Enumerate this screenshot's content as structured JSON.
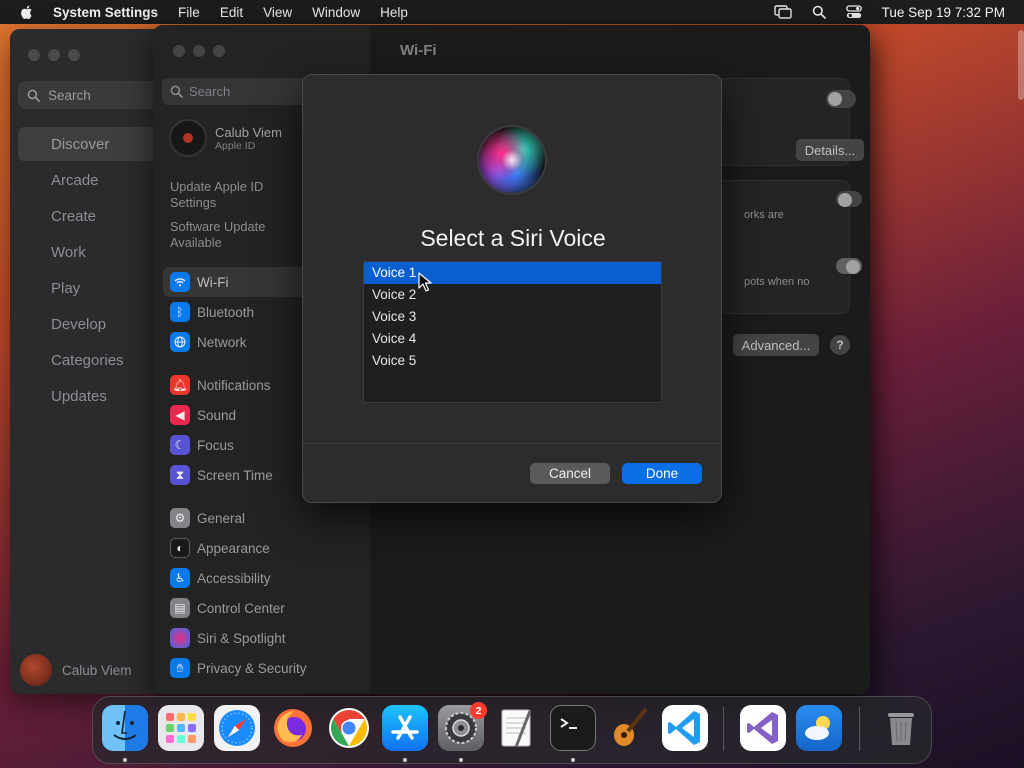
{
  "menubar": {
    "app_name": "System Settings",
    "menus": [
      "File",
      "Edit",
      "View",
      "Window",
      "Help"
    ],
    "clock": "Tue Sep 19  7:32 PM"
  },
  "appstore": {
    "search_placeholder": "Search",
    "nav": [
      "Discover",
      "Arcade",
      "Create",
      "Work",
      "Play",
      "Develop",
      "Categories",
      "Updates"
    ],
    "active_nav": "Discover",
    "user_name": "Calub Viem"
  },
  "settings": {
    "search_placeholder": "Search",
    "user": {
      "name": "Calub Viem",
      "subtitle": "Apple ID"
    },
    "update_apple_id": "Update Apple ID Settings",
    "software_update": "Software Update Available",
    "nav_group1": [
      {
        "label": "Wi-Fi",
        "icon": "wifi-icon",
        "color": "#0a84ff"
      },
      {
        "label": "Bluetooth",
        "icon": "bluetooth-icon",
        "color": "#0a84ff"
      },
      {
        "label": "Network",
        "icon": "globe-icon",
        "color": "#0a84ff"
      }
    ],
    "nav_group2": [
      {
        "label": "Notifications",
        "icon": "bell-icon",
        "color": "#ff3b30"
      },
      {
        "label": "Sound",
        "icon": "speaker-icon",
        "color": "#ff2d55"
      },
      {
        "label": "Focus",
        "icon": "moon-icon",
        "color": "#5e5ce6"
      },
      {
        "label": "Screen Time",
        "icon": "hourglass-icon",
        "color": "#5e5ce6"
      }
    ],
    "nav_group3": [
      {
        "label": "General",
        "icon": "gear-icon",
        "color": "#8e8e93"
      },
      {
        "label": "Appearance",
        "icon": "appearance-icon",
        "color": "#1c1c1e"
      },
      {
        "label": "Accessibility",
        "icon": "accessibility-icon",
        "color": "#0a84ff"
      },
      {
        "label": "Control Center",
        "icon": "control-center-icon",
        "color": "#8e8e93"
      },
      {
        "label": "Siri & Spotlight",
        "icon": "siri-icon",
        "color": "#bf5af2"
      },
      {
        "label": "Privacy & Security",
        "icon": "hand-icon",
        "color": "#0a84ff"
      }
    ],
    "main_title": "Wi-Fi",
    "details_label": "Details...",
    "networks_fragment": "orks are",
    "hotspots_fragment": "pots when no",
    "advanced_label": "Advanced...",
    "help_label": "?"
  },
  "sheet": {
    "title": "Select a Siri Voice",
    "voices": [
      "Voice 1",
      "Voice 2",
      "Voice 3",
      "Voice 4",
      "Voice 5"
    ],
    "selected_index": 0,
    "cancel_label": "Cancel",
    "done_label": "Done"
  },
  "dock": {
    "settings_badge": "2",
    "apps": [
      "Finder",
      "Launchpad",
      "Safari",
      "Firefox",
      "Chrome",
      "App Store",
      "System Settings",
      "TextEdit",
      "Terminal",
      "GarageBand",
      "Visual Studio Code",
      "Visual Studio",
      "Weather",
      "Trash"
    ]
  },
  "colors": {
    "accent": "#0a5fd0",
    "done_button": "#0a6ee6",
    "badge": "#ff3b30"
  }
}
